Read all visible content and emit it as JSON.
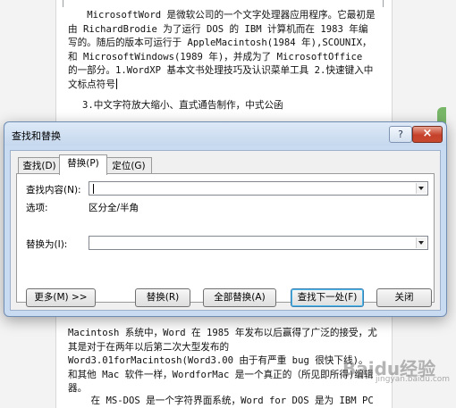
{
  "document": {
    "paragraph_top": "MicrosoftWord 是微软公司的一个文字处理器应用程序。它最初是由 RichardBrodie 为了运行 DOS 的 IBM 计算机而在 1983 年编写的。随后的版本可运行于 AppleMacintosh(1984 年),SCOUNIX，和 MicrosoftWindows(1989 年)，并成为了 MicrosoftOffice 的一部分。1.WordXP 基本文书处理技巧及认识菜单工具  2.快速键入中文标点符号",
    "line3": "3.中文字符放大缩小、直式通告制作，中式公函",
    "paragraph_bottom": "Macintosh 系统中，Word 在 1985 年发布以后赢得了广泛的接受，尤其是对于在两年以后第二次大型发布的 Word3.01forMacintosh(Word3.00 由于有严重 bug 很快下线)。和其他 Mac 软件一样，WordforMac 是一个真正的（所见即所得)编辑器。",
    "last_line": "    在 MS-DOS 是一个字符界面系统，Word for DOS 是为 IBM PC 研发"
  },
  "dialog": {
    "title": "查找和替换",
    "help_glyph": "?",
    "close_glyph": "×",
    "tabs": [
      {
        "label": "查找(D)",
        "active": false
      },
      {
        "label": "替换(P)",
        "active": true
      },
      {
        "label": "定位(G)",
        "active": false
      }
    ],
    "find_label": "查找内容(N):",
    "find_value": "",
    "options_label": "选项:",
    "options_value": "区分全/半角",
    "replace_label": "替换为(I):",
    "replace_value": "",
    "buttons": {
      "more": "更多(M) >>",
      "replace": "替换(R)",
      "replace_all": "全部替换(A)",
      "find_next": "查找下一处(F)",
      "close": "关闭"
    }
  },
  "watermark": {
    "text": "Baidu经验",
    "sub": "jingyan.baidu.com"
  }
}
